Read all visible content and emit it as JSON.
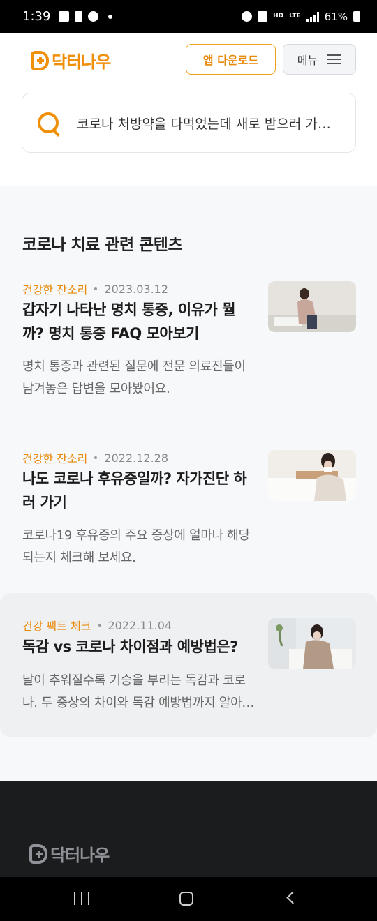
{
  "status_bar": {
    "time": "1:39",
    "battery": "61%",
    "network": "LTE",
    "hd": "HD"
  },
  "header": {
    "logo_text": "닥터나우",
    "download_button": "앱 다운로드",
    "menu_button": "메뉴"
  },
  "search": {
    "text": "코로나 처방약을 다먹었는데 새로 받으러 가야하나요?"
  },
  "section": {
    "title": "코로나 치료 관련 콘텐츠"
  },
  "articles": [
    {
      "category": "건강한 잔소리",
      "date": "2023.03.12",
      "title": "갑자기 나타난 명치 통증, 이유가 뭘까? 명치 통증 FAQ 모아보기",
      "desc": "명치 통증과 관련된 질문에 전문 의료진들이 남겨놓은 답변을 모아봤어요."
    },
    {
      "category": "건강한 잔소리",
      "date": "2022.12.28",
      "title": "나도 코로나 후유증일까? 자가진단 하러 가기",
      "desc": "코로나19 후유증의 주요 증상에 얼마나 해당되는지 체크해 보세요."
    },
    {
      "category": "건강 팩트 체크",
      "date": "2022.11.04",
      "title": "독감 vs 코로나 차이점과 예방법은?",
      "desc": "날이 추워질수록 기승을 부리는 독감과 코로나. 두 증상의 차이와 독감 예방법까지 알아봐요."
    }
  ],
  "footer": {
    "logo_text": "닥터나우"
  },
  "colors": {
    "accent": "#f0900a",
    "footer_bg": "#1b1c1e",
    "content_bg": "#f7f8fa"
  }
}
